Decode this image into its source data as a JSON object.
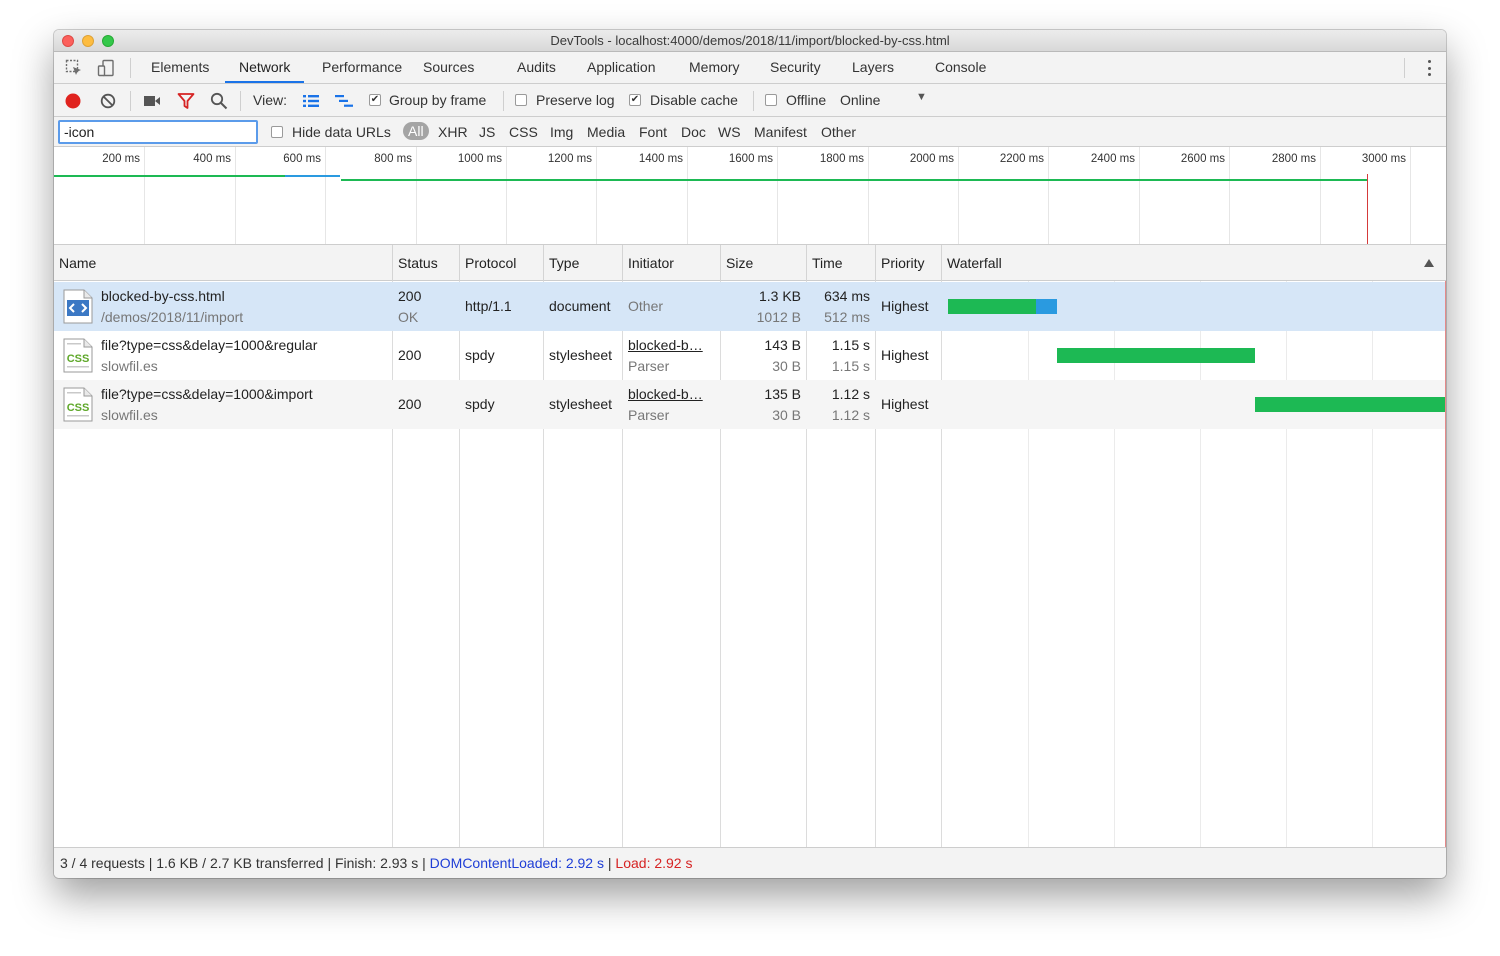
{
  "window": {
    "title": "DevTools - localhost:4000/demos/2018/11/import/blocked-by-css.html"
  },
  "tabs": [
    {
      "label": "Elements"
    },
    {
      "label": "Network"
    },
    {
      "label": "Performance"
    },
    {
      "label": "Sources"
    },
    {
      "label": "Audits"
    },
    {
      "label": "Application"
    },
    {
      "label": "Memory"
    },
    {
      "label": "Security"
    },
    {
      "label": "Layers"
    },
    {
      "label": "Console"
    }
  ],
  "active_tab": "Network",
  "toolbar": {
    "view_label": "View:",
    "group_by_frame": {
      "label": "Group by frame",
      "checked": true
    },
    "preserve_log": {
      "label": "Preserve log",
      "checked": false
    },
    "disable_cache": {
      "label": "Disable cache",
      "checked": true
    },
    "offline": {
      "label": "Offline",
      "checked": false
    },
    "throttling": "Online",
    "record_color": "#e0231e",
    "filter_icon_color": "#d62323",
    "view_icon_color": "#1a73e8"
  },
  "filter": {
    "value": "-icon",
    "hide_data_urls": "Hide data URLs",
    "types": [
      "All",
      "XHR",
      "JS",
      "CSS",
      "Img",
      "Media",
      "Font",
      "Doc",
      "WS",
      "Manifest",
      "Other"
    ],
    "active_type": "All"
  },
  "overview": {
    "ticks": [
      "200 ms",
      "400 ms",
      "600 ms",
      "800 ms",
      "1000 ms",
      "1200 ms",
      "1400 ms",
      "1600 ms",
      "1800 ms",
      "2000 ms",
      "2200 ms",
      "2400 ms",
      "2600 ms",
      "2800 ms",
      "3000 ms"
    ],
    "colors": {
      "waiting": "#1db954",
      "download": "#2a9ae0",
      "load": "#d53a3a"
    }
  },
  "columns": {
    "name": "Name",
    "status": "Status",
    "protocol": "Protocol",
    "type": "Type",
    "initiator": "Initiator",
    "size": "Size",
    "time": "Time",
    "priority": "Priority",
    "waterfall": "Waterfall"
  },
  "requests": [
    {
      "name": "blocked-by-css.html",
      "path": "/demos/2018/11/import",
      "icon": "html-document-icon",
      "status": "200",
      "status_text": "OK",
      "protocol": "http/1.1",
      "type": "document",
      "initiator": "Other",
      "initiator_sub": "",
      "size": "1.3 KB",
      "size_sub": "1012 B",
      "time": "634 ms",
      "time_sub": "512 ms",
      "priority": "Highest",
      "timing_ms": {
        "start": 0,
        "waiting_end": 512,
        "end": 634
      }
    },
    {
      "name": "file?type=css&delay=1000&regular",
      "path": "slowfil.es",
      "icon": "css-file-icon",
      "status": "200",
      "status_text": "",
      "protocol": "spdy",
      "type": "stylesheet",
      "initiator": "blocked-b…",
      "initiator_sub": "Parser",
      "size": "143 B",
      "size_sub": "30 B",
      "time": "1.15 s",
      "time_sub": "1.15 s",
      "priority": "Highest",
      "timing_ms": {
        "start": 634,
        "waiting_end": 1784,
        "end": 1784
      }
    },
    {
      "name": "file?type=css&delay=1000&import",
      "path": "slowfil.es",
      "icon": "css-file-icon",
      "status": "200",
      "status_text": "",
      "protocol": "spdy",
      "type": "stylesheet",
      "initiator": "blocked-b…",
      "initiator_sub": "Parser",
      "size": "135 B",
      "size_sub": "30 B",
      "time": "1.12 s",
      "time_sub": "1.12 s",
      "priority": "Highest",
      "timing_ms": {
        "start": 1784,
        "waiting_end": 2904,
        "end": 2904
      }
    }
  ],
  "status_bar": {
    "summary": "3 / 4 requests | 1.6 KB / 2.7 KB transferred | Finish: 2.93 s | ",
    "dcl": "DOMContentLoaded: 2.92 s",
    "divider": " | ",
    "load": "Load: 2.92 s"
  }
}
